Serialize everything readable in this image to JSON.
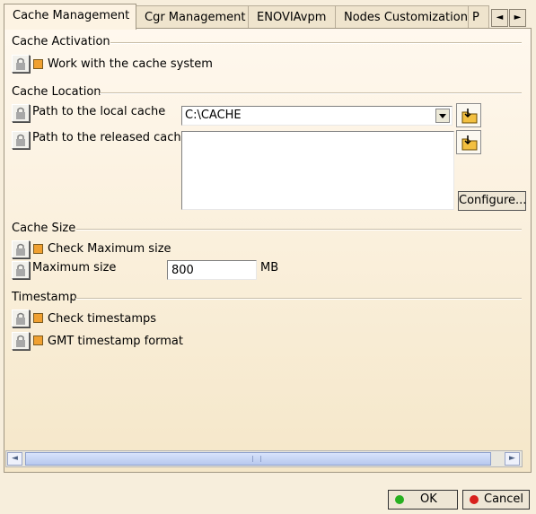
{
  "tabs": [
    {
      "label": "Cache Management",
      "active": true
    },
    {
      "label": "Cgr Management",
      "active": false
    },
    {
      "label": "ENOVIAvpm",
      "active": false
    },
    {
      "label": "Nodes Customization",
      "active": false
    },
    {
      "label": "P",
      "active": false
    }
  ],
  "tab_scroll": {
    "left": "◄",
    "right": "►"
  },
  "sections": {
    "activation": {
      "title": "Cache Activation",
      "work_with_cache": {
        "label": "Work with the cache system",
        "checked": true
      }
    },
    "location": {
      "title": "Cache Location",
      "local_cache_label": "Path to the local cache",
      "local_cache_value": "C:\\CACHE",
      "released_cache_label": "Path to the released cache",
      "released_cache_value": "",
      "configure_label": "Configure..."
    },
    "size": {
      "title": "Cache Size",
      "check_max": {
        "label": "Check Maximum size",
        "checked": true
      },
      "max_size_label": "Maximum size",
      "max_size_value": "800",
      "max_size_unit": "MB"
    },
    "timestamp": {
      "title": "Timestamp",
      "check_timestamps": {
        "label": "Check timestamps",
        "checked": true
      },
      "gmt_format": {
        "label": "GMT timestamp format",
        "checked": true
      }
    }
  },
  "scrollbar": {
    "left": "◄",
    "right": "►"
  },
  "dialog": {
    "ok_label": "OK",
    "cancel_label": "Cancel"
  },
  "colors": {
    "checkbox": "#f0a030",
    "ok_dot": "#27b020",
    "cancel_dot": "#d8201c"
  }
}
